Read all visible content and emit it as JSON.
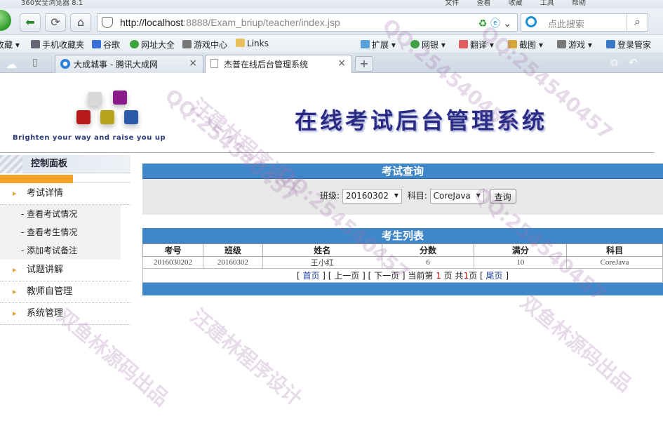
{
  "browser": {
    "window_title": "360安全浏览器 8.1",
    "menus": [
      "文件",
      "查看",
      "收藏",
      "工具",
      "帮助"
    ],
    "url_host": "http://localhost",
    "url_rest": ":8888/Exam_briup/teacher/index.jsp",
    "search_placeholder": "点此搜索",
    "bookmarks_left": [
      "收藏",
      "手机收藏夹",
      "谷歌",
      "网址大全",
      "游戏中心",
      "Links"
    ],
    "bookmarks_right": [
      "扩展",
      "网银",
      "翻译",
      "截图",
      "游戏",
      "登录管家"
    ],
    "tabs": [
      {
        "label": "大成城事 - 腾讯大成网",
        "active": false
      },
      {
        "label": "杰普在线后台管理系统",
        "active": true
      }
    ]
  },
  "header": {
    "slogan": "Brighten your way and raise you up",
    "title": "在线考试后台管理系统"
  },
  "sidebar": {
    "panel_title": "控制面板",
    "sections": [
      {
        "label": "考试详情",
        "items": [
          "- 查看考试情况",
          "- 查看考生情况",
          "- 添加考试备注"
        ]
      },
      {
        "label": "试题讲解",
        "items": []
      },
      {
        "label": "教师自管理",
        "items": []
      },
      {
        "label": "系统管理",
        "items": []
      }
    ]
  },
  "query": {
    "title": "考试查询",
    "class_label": "班级:",
    "class_value": "20160302",
    "subject_label": "科目:",
    "subject_value": "CoreJava",
    "button": "查询"
  },
  "list": {
    "title": "考生列表",
    "columns": [
      "考号",
      "班级",
      "姓名",
      "分数",
      "满分",
      "科目"
    ],
    "rows": [
      [
        "2016030202",
        "20160302",
        "王小红",
        "6",
        "10",
        "CoreJava"
      ]
    ]
  },
  "pager": {
    "first": "首页",
    "prev": "[ 上一页 ]",
    "next": "[ 下一页 ]",
    "current_prefix": "当前第",
    "current": "1",
    "current_suffix": "页 共",
    "total": "1",
    "total_suffix": "页",
    "last": "尾页"
  },
  "watermark": [
    "汪建林程序设计",
    "QQ:254540457",
    "双鱼林源码出品"
  ]
}
